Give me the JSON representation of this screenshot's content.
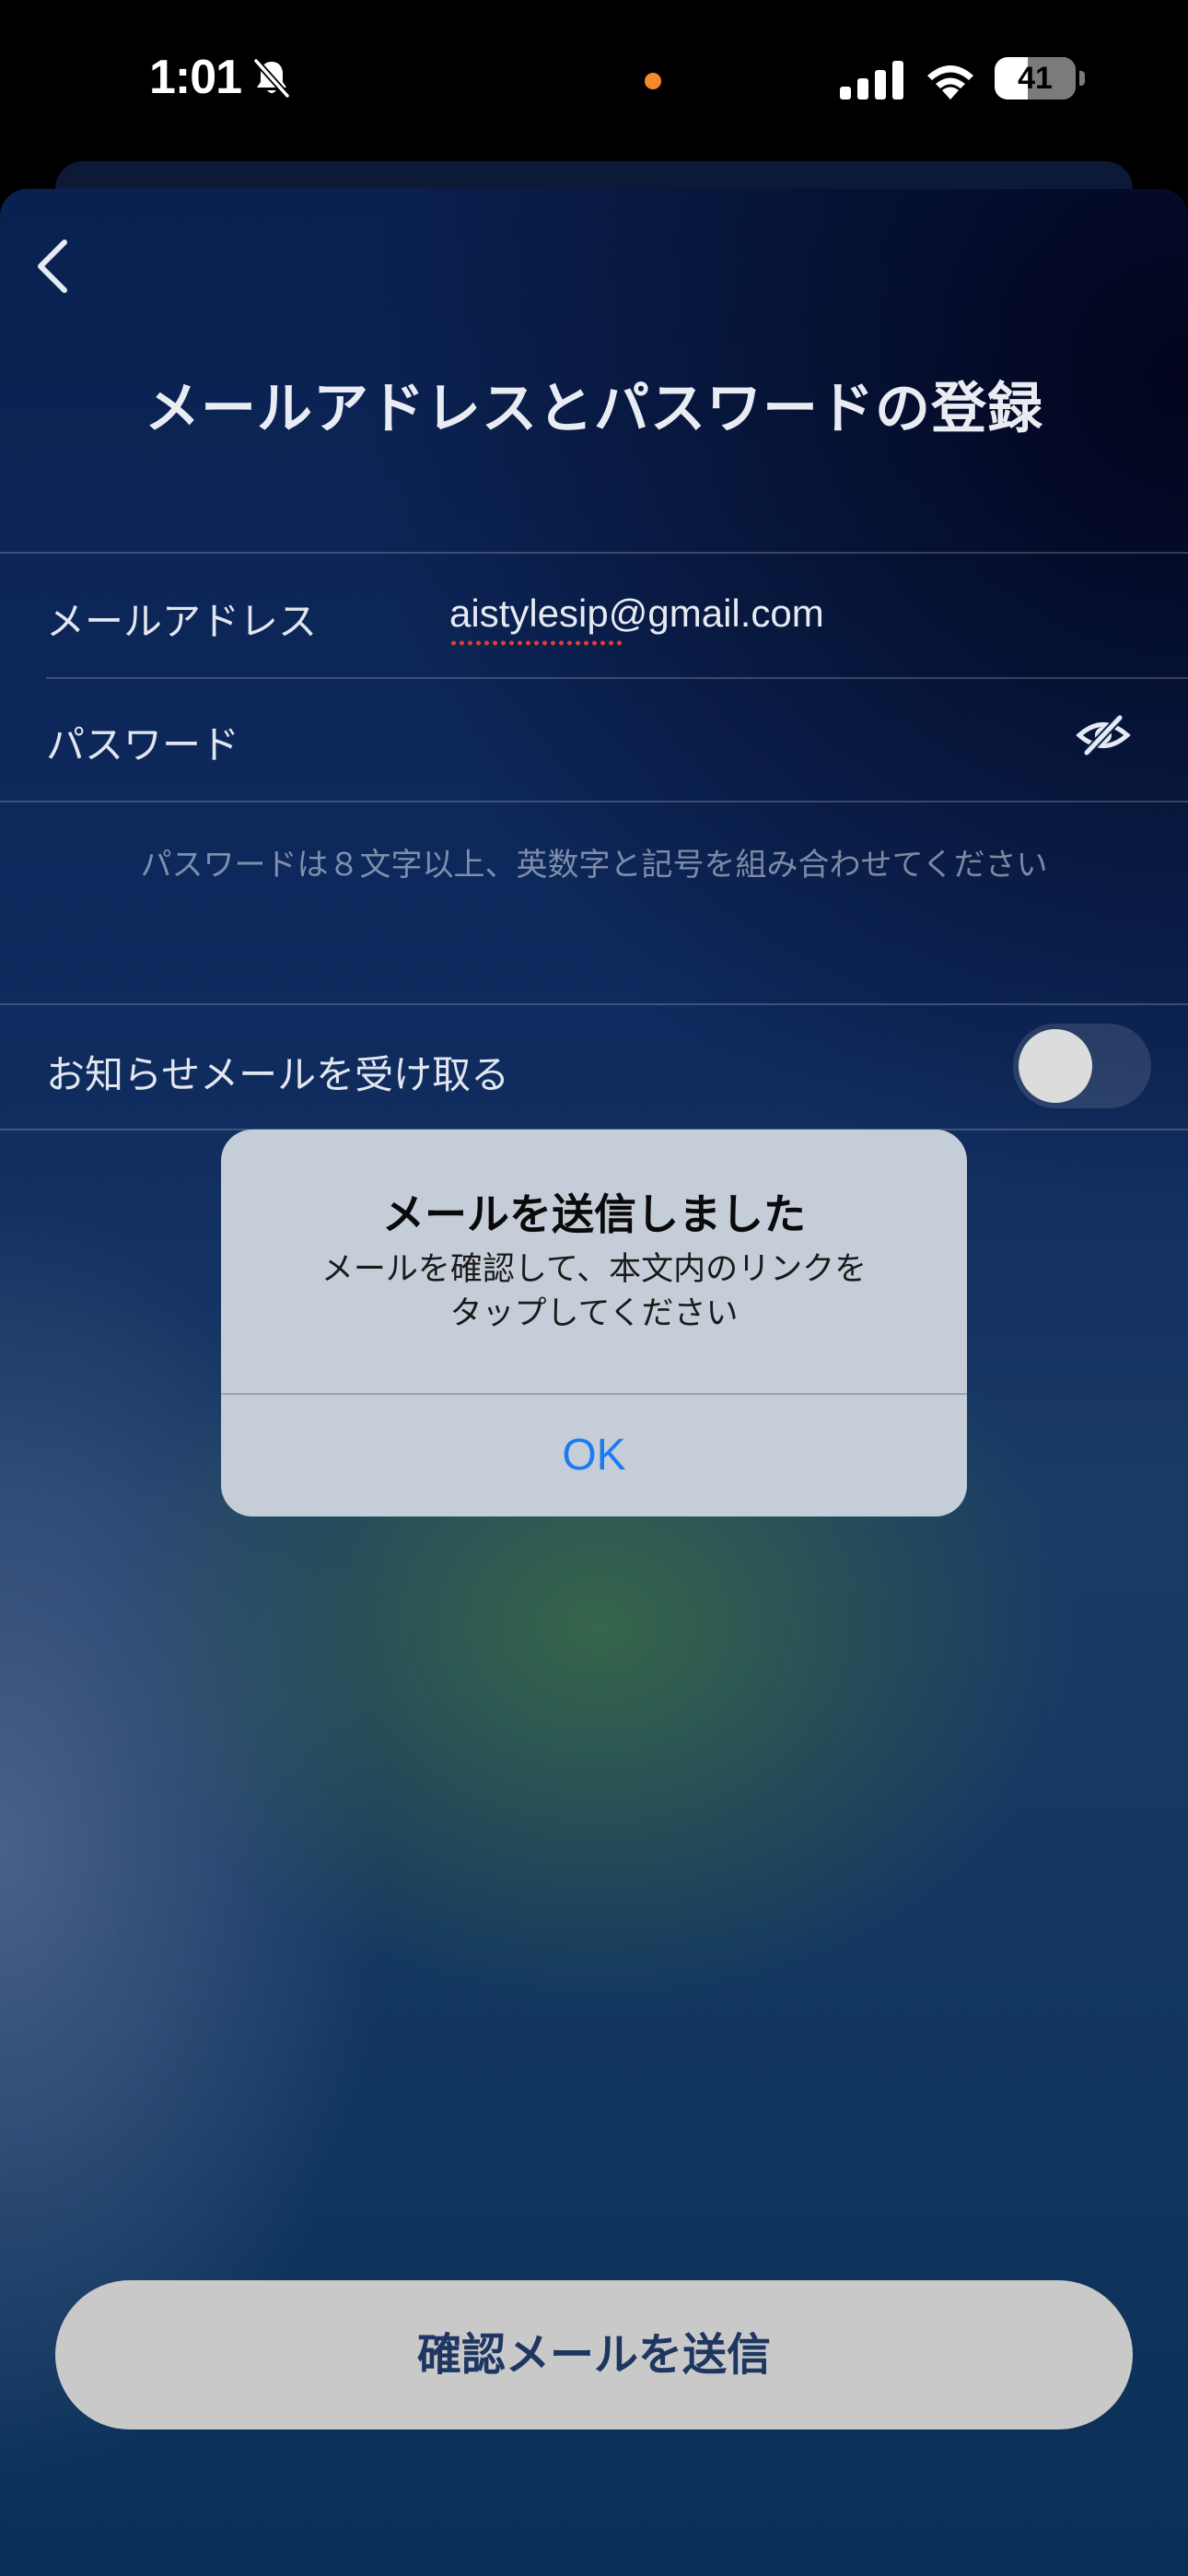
{
  "status_bar": {
    "time": "1:01",
    "battery": "41",
    "icons": [
      "bell-slash-icon",
      "signal-icon",
      "wifi-icon",
      "battery-icon"
    ],
    "indicator_color": "#f58a2c"
  },
  "header": {
    "back_icon": "chevron-left-icon",
    "title": "メールアドレスとパスワードの登録"
  },
  "form": {
    "email_label": "メールアドレス",
    "email_value": "aistylesip@gmail.com",
    "password_label": "パスワード",
    "password_icon": "eye-slash-icon",
    "password_hint": "パスワードは８文字以上、英数字と記号を組み合わせてください",
    "newsletter_label": "お知らせメールを受け取る",
    "newsletter_enabled": false
  },
  "primary_button": {
    "label": "確認メールを送信"
  },
  "alert": {
    "title": "メールを送信しました",
    "message": "メールを確認して、本文内のリンクを\nタップしてください",
    "ok_label": "OK",
    "ok_color": "#1a7cf0"
  }
}
